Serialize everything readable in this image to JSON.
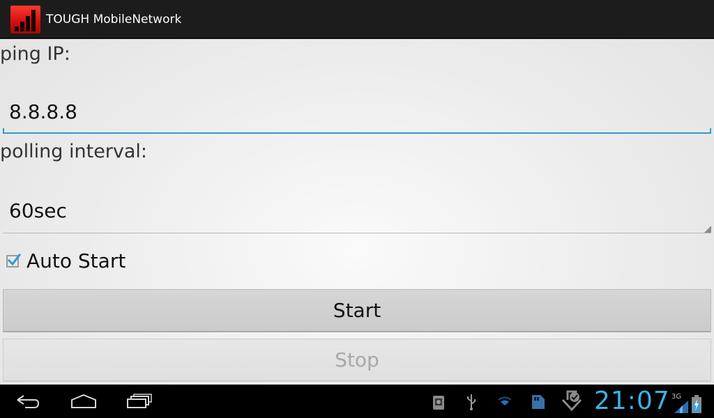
{
  "app": {
    "title": "TOUGH MobileNetwork",
    "icon": "signal-bars-icon"
  },
  "form": {
    "ping_label": "ping IP:",
    "ping_value": "8.8.8.8",
    "interval_label": "polling interval:",
    "interval_value": "60sec",
    "auto_start_label": "Auto Start",
    "auto_start_checked": true
  },
  "buttons": {
    "start_label": "Start",
    "stop_label": "Stop"
  },
  "system_bar": {
    "nav": [
      "back-icon",
      "home-icon",
      "recent-apps-icon"
    ],
    "status_icons": [
      "android-debug-icon",
      "usb-icon",
      "wifi-icon",
      "sd-card-icon",
      "download-icon"
    ],
    "time": "21:07",
    "network": "3G"
  },
  "colors": {
    "accent": "#2a9bd0",
    "clock": "#3ab2e8",
    "action_bar": "#1c1c1c",
    "app_icon": "#e0201a"
  }
}
